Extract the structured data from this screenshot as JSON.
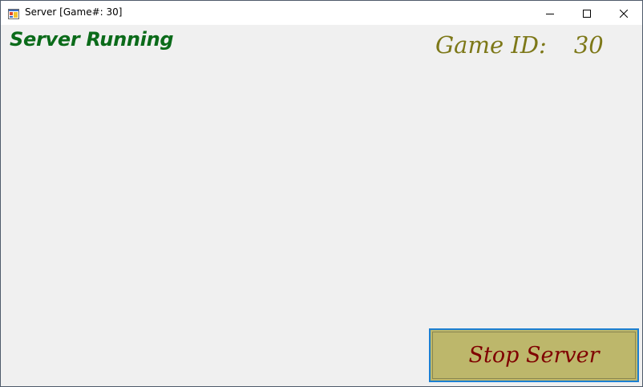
{
  "window": {
    "title": "Server [Game#: 30]",
    "icon": "app-window-icon",
    "controls": {
      "minimize_icon": "minimize-icon",
      "maximize_icon": "maximize-icon",
      "close_icon": "close-icon"
    }
  },
  "main": {
    "status_label": "Server Running",
    "game_id_label": "Game ID:",
    "game_id_value": "30",
    "stop_button_label": "Stop Server"
  },
  "colors": {
    "status_text": "#0b6b1a",
    "game_id_text": "#7d7818",
    "stop_button_bg": "#bdb76b",
    "stop_button_text": "#7f0000",
    "stop_button_focus_border": "#1c7fd1",
    "window_bg": "#f0f0f0"
  }
}
